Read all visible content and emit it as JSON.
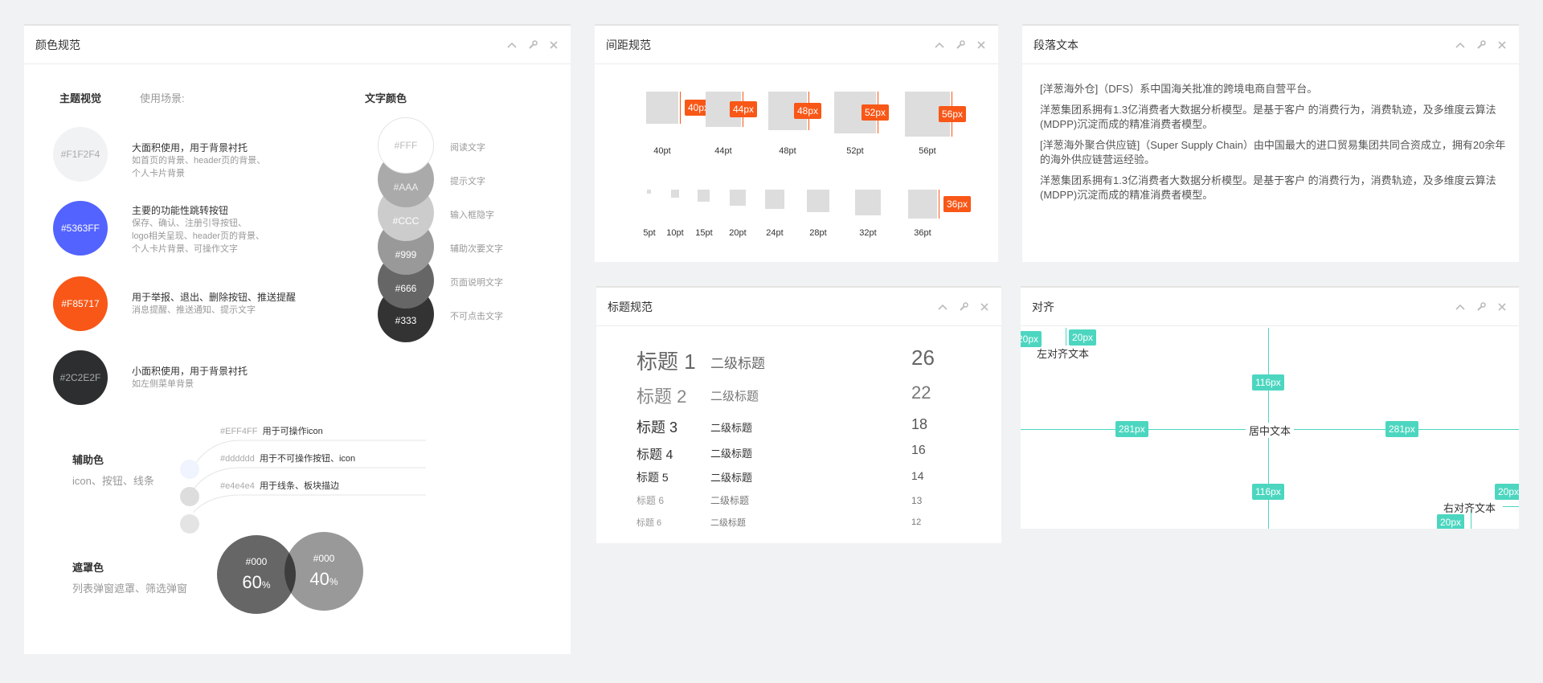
{
  "panel_tools": {
    "collapse_icon": "chevron-up",
    "settings_icon": "wrench",
    "close_icon": "close"
  },
  "color_panel": {
    "title": "颜色规范",
    "theme_heading": "主题视觉",
    "usage_heading": "使用场景:",
    "text_color_heading": "文字颜色",
    "theme_colors": [
      {
        "hex": "#F1F2F4",
        "label": "#F1F2F4",
        "title": "大面积使用，用于背景衬托",
        "lines": [
          "如首页的背景、header页的背景、",
          "个人卡片背景"
        ]
      },
      {
        "hex": "#5363FF",
        "label": "#5363FF",
        "title": "主要的功能性跳转按钮",
        "lines": [
          "保存、确认、注册引导按钮、",
          "logo相关呈现、header页的背景、",
          "个人卡片背景、可操作文字"
        ]
      },
      {
        "hex": "#F85717",
        "label": "#F85717",
        "title": "用于举报、退出、删除按钮、推送提醒",
        "lines": [
          "消息提醒、推送通知、提示文字"
        ]
      },
      {
        "hex": "#2C2E2F",
        "label": "#2C2E2F",
        "title": "小面积使用，用于背景衬托",
        "lines": [
          "如左侧菜单背景"
        ]
      }
    ],
    "text_colors": [
      {
        "hex": "#FFF",
        "label": "#FFF",
        "desc": "阅读文字"
      },
      {
        "hex": "#AAA",
        "label": "#AAA",
        "desc": "提示文字"
      },
      {
        "hex": "#CCC",
        "label": "#CCC",
        "desc": "输入框隐字"
      },
      {
        "hex": "#999",
        "label": "#999",
        "desc": "辅助次要文字"
      },
      {
        "hex": "#666",
        "label": "#666",
        "desc": "页面说明文字"
      },
      {
        "hex": "#333",
        "label": "#333",
        "desc": "不可点击文字"
      }
    ],
    "aux": {
      "title": "辅助色",
      "subtitle": "icon、按钮、线条",
      "items": [
        {
          "hex": "#EFF4FF",
          "code": "#EFF4FF",
          "desc": "用于可操作icon"
        },
        {
          "hex": "#dddddd",
          "code": "#dddddd",
          "desc": "用于不可操作按钮、icon"
        },
        {
          "hex": "#e4e4e4",
          "code": "#e4e4e4",
          "desc": "用于线条、板块描边"
        }
      ]
    },
    "mask": {
      "title": "遮罩色",
      "subtitle": "列表弹窗遮罩、筛选弹窗",
      "items": [
        {
          "code": "#000",
          "opacity": "60",
          "unit": "%"
        },
        {
          "code": "#000",
          "opacity": "40",
          "unit": "%"
        }
      ]
    }
  },
  "spacing_panel": {
    "title": "间距规范",
    "large": [
      {
        "tag": "40px",
        "label": "40pt"
      },
      {
        "tag": "44px",
        "label": "44pt"
      },
      {
        "tag": "48px",
        "label": "48pt"
      },
      {
        "tag": "52px",
        "label": "52pt"
      },
      {
        "tag": "56px",
        "label": "56pt"
      }
    ],
    "small": [
      {
        "label": "5pt"
      },
      {
        "label": "10pt"
      },
      {
        "label": "15pt"
      },
      {
        "label": "20pt"
      },
      {
        "label": "24pt"
      },
      {
        "label": "28pt"
      },
      {
        "label": "32pt"
      },
      {
        "label": "36pt",
        "tag": "36px"
      }
    ]
  },
  "paragraph_panel": {
    "title": "段落文本",
    "paragraphs": [
      "[洋葱海外仓]（DFS）系中国海关批准的跨境电商自营平台。",
      "洋葱集团系拥有1.3亿消费者大数据分析模型。是基于客户 的消费行为，消费轨迹，及多维度云算法(MDPP)沉淀而成的精准消费者模型。",
      "[洋葱海外聚合供应链]（Super Supply Chain）由中国最大的进口贸易集团共同合资成立，拥有20余年的海外供应链营运经验。",
      "洋葱集团系拥有1.3亿消费者大数据分析模型。是基于客户 的消费行为，消费轨迹，及多维度云算法(MDPP)沉淀而成的精准消费者模型。"
    ]
  },
  "heading_panel": {
    "title": "标题规范",
    "rows": [
      {
        "name": "标题 1",
        "sub": "二级标题",
        "size": "26"
      },
      {
        "name": "标题 2",
        "sub": "二级标题",
        "size": "22"
      },
      {
        "name": "标题 3",
        "sub": "二级标题",
        "size": "18"
      },
      {
        "name": "标题 4",
        "sub": "二级标题",
        "size": "16"
      },
      {
        "name": "标题 5",
        "sub": "二级标题",
        "size": "14"
      },
      {
        "name": "标题 6",
        "sub": "二级标题",
        "size": "13"
      },
      {
        "name": "标题 6",
        "sub": "二级标题",
        "size": "12"
      }
    ]
  },
  "align_panel": {
    "title": "对齐",
    "left_text": "左对齐文本",
    "center_text": "居中文本",
    "right_text": "右对齐文本",
    "tag_20": "20px",
    "tag_116": "116px",
    "tag_281": "281px",
    "accent": "#4CD6C0"
  }
}
